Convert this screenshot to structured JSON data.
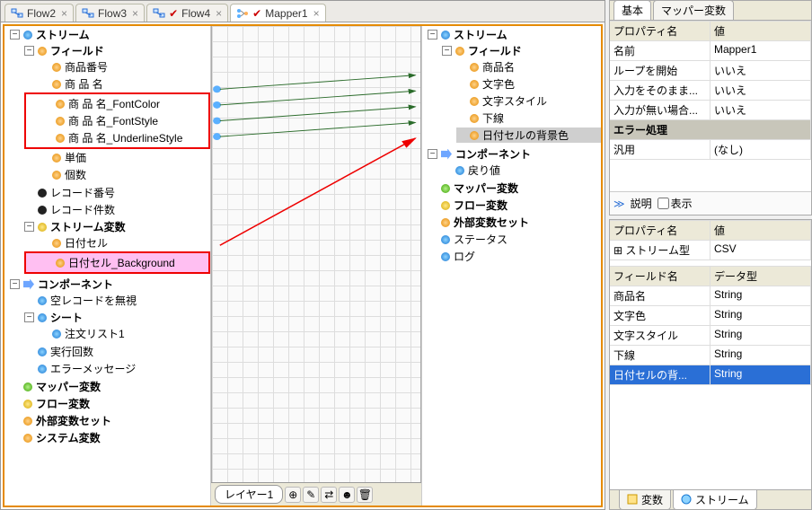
{
  "tabs": [
    {
      "label": "Flow2"
    },
    {
      "label": "Flow3"
    },
    {
      "label": "Flow4"
    },
    {
      "label": "Mapper1",
      "active": true
    }
  ],
  "src_tree": {
    "root": "ストリーム",
    "field": "フィールド",
    "items": [
      "商品番号",
      "商 品 名",
      "商 品 名_FontColor",
      "商 品 名_FontStyle",
      "商 品 名_UnderlineStyle",
      "単価",
      "個数"
    ],
    "record_no": "レコード番号",
    "record_count": "レコード件数",
    "stream_var": "ストリーム変数",
    "date_cell": "日付セル",
    "date_bg": "日付セル_Background",
    "component": "コンポーネント",
    "ignore_empty": "空レコードを無視",
    "sheet": "シート",
    "order_list": "注文リスト1",
    "exec_count": "実行回数",
    "err_msg": "エラーメッセージ",
    "mapper_var": "マッパー変数",
    "flow_var": "フロー変数",
    "ext_var": "外部変数セット",
    "sys_var": "システム変数"
  },
  "dst_tree": {
    "root": "ストリーム",
    "field": "フィールド",
    "name": "商品名",
    "color": "文字色",
    "style": "文字スタイル",
    "underline": "下線",
    "date_bg": "日付セルの背景色",
    "component": "コンポーネント",
    "ret": "戻り値",
    "mapper_var": "マッパー変数",
    "flow_var": "フロー変数",
    "ext_var": "外部変数セット",
    "status": "ステータス",
    "log": "ログ"
  },
  "layer_label": "レイヤー1",
  "right_tabs": {
    "tab1": "基本",
    "tab2": "マッパー変数"
  },
  "prop1": {
    "hdr_name": "プロパティ名",
    "hdr_val": "値",
    "rows": [
      [
        "名前",
        "Mapper1"
      ],
      [
        "ループを開始",
        "いいえ"
      ],
      [
        "入力をそのまま...",
        "いいえ"
      ],
      [
        "入力が無い場合...",
        "いいえ"
      ]
    ],
    "err_hdr": "エラー処理",
    "generic": [
      "汎用",
      "(なし)"
    ]
  },
  "desc": {
    "label": "説明",
    "show": "表示"
  },
  "prop2": {
    "hdr_name": "プロパティ名",
    "hdr_val": "値",
    "rows": [
      [
        "ストリーム型",
        "CSV"
      ]
    ]
  },
  "fields": {
    "hdr_name": "フィールド名",
    "hdr_type": "データ型",
    "rows": [
      [
        "商品名",
        "String"
      ],
      [
        "文字色",
        "String"
      ],
      [
        "文字スタイル",
        "String"
      ],
      [
        "下線",
        "String"
      ],
      [
        "日付セルの背...",
        "String"
      ]
    ]
  },
  "bottom_tabs": {
    "var": "変数",
    "stream": "ストリーム"
  }
}
